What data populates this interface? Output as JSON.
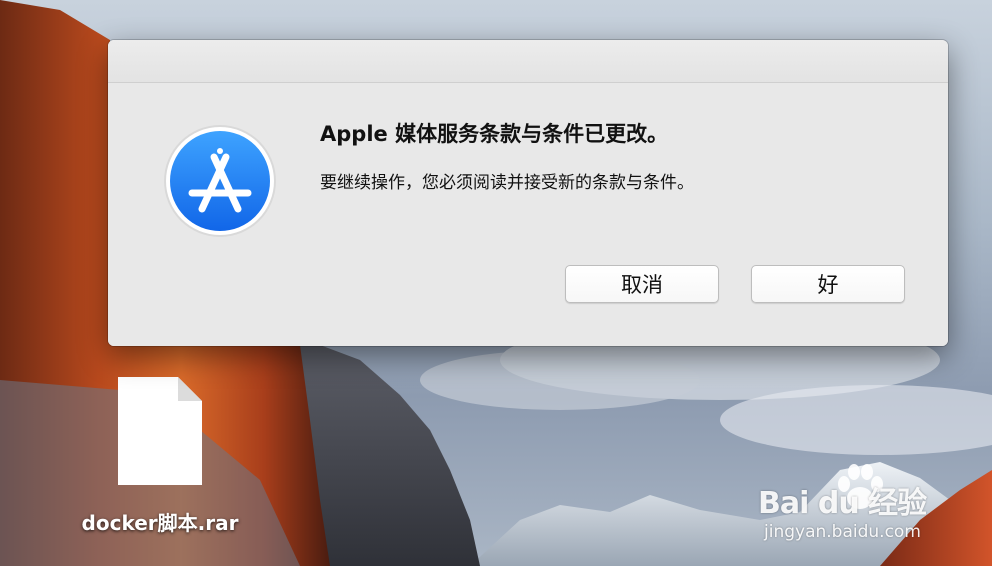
{
  "dialog": {
    "title": "Apple 媒体服务条款与条件已更改。",
    "message": "要继续操作，您必须阅读并接受新的条款与条件。",
    "cancel_label": "取消",
    "ok_label": "好",
    "icon": "app-store-icon"
  },
  "desktop": {
    "file_name": "docker脚本.rar",
    "file_icon": "document-icon"
  },
  "watermark": {
    "brand": "Bai du 经验",
    "url": "jingyan.baidu.com"
  },
  "colors": {
    "dialog_background": "#ececec",
    "app_icon_blue": "#1f7cf3",
    "button_background": "#ffffff"
  }
}
